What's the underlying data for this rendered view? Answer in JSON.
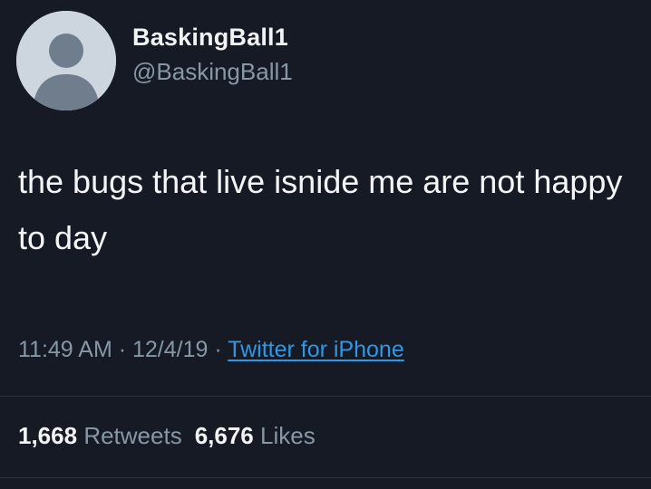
{
  "user": {
    "display_name": "BaskingBall1",
    "handle": "@BaskingBall1"
  },
  "tweet": {
    "text": "the bugs that live isnide me are not happy to day",
    "time": "11:49 AM",
    "date": "12/4/19",
    "source": "Twitter for iPhone",
    "separator": " · "
  },
  "stats": {
    "retweets_count": "1,668",
    "retweets_label": "Retweets",
    "likes_count": "6,676",
    "likes_label": "Likes"
  },
  "colors": {
    "background": "#161a24",
    "secondary_text": "#8797a6",
    "link": "#2d97e8",
    "avatar_bg": "#cdd6df"
  },
  "icons": {
    "avatar": "default-profile-icon"
  }
}
